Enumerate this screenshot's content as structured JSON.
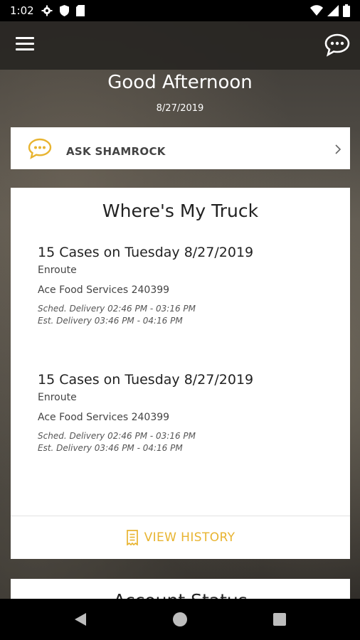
{
  "status_bar": {
    "time": "1:02"
  },
  "header": {
    "greeting": "Good Afternoon",
    "date": "8/27/2019"
  },
  "ask": {
    "label": "ASK SHAMROCK"
  },
  "truck": {
    "title": "Where's My Truck",
    "deliveries": [
      {
        "title": "15 Cases on Tuesday 8/27/2019",
        "status": "Enroute",
        "account": "Ace Food Services 240399",
        "sched": "Sched. Delivery 02:46 PM - 03:16 PM",
        "est": "Est. Delivery 03:46 PM - 04:16 PM"
      },
      {
        "title": "15 Cases on Tuesday 8/27/2019",
        "status": "Enroute",
        "account": "Ace Food Services 240399",
        "sched": "Sched. Delivery 02:46 PM - 03:16 PM",
        "est": "Est. Delivery 03:46 PM - 04:16 PM"
      }
    ],
    "history_label": "VIEW HISTORY"
  },
  "account": {
    "title": "Account Status"
  },
  "colors": {
    "accent": "#e8b430",
    "app_bar": "#282623"
  }
}
